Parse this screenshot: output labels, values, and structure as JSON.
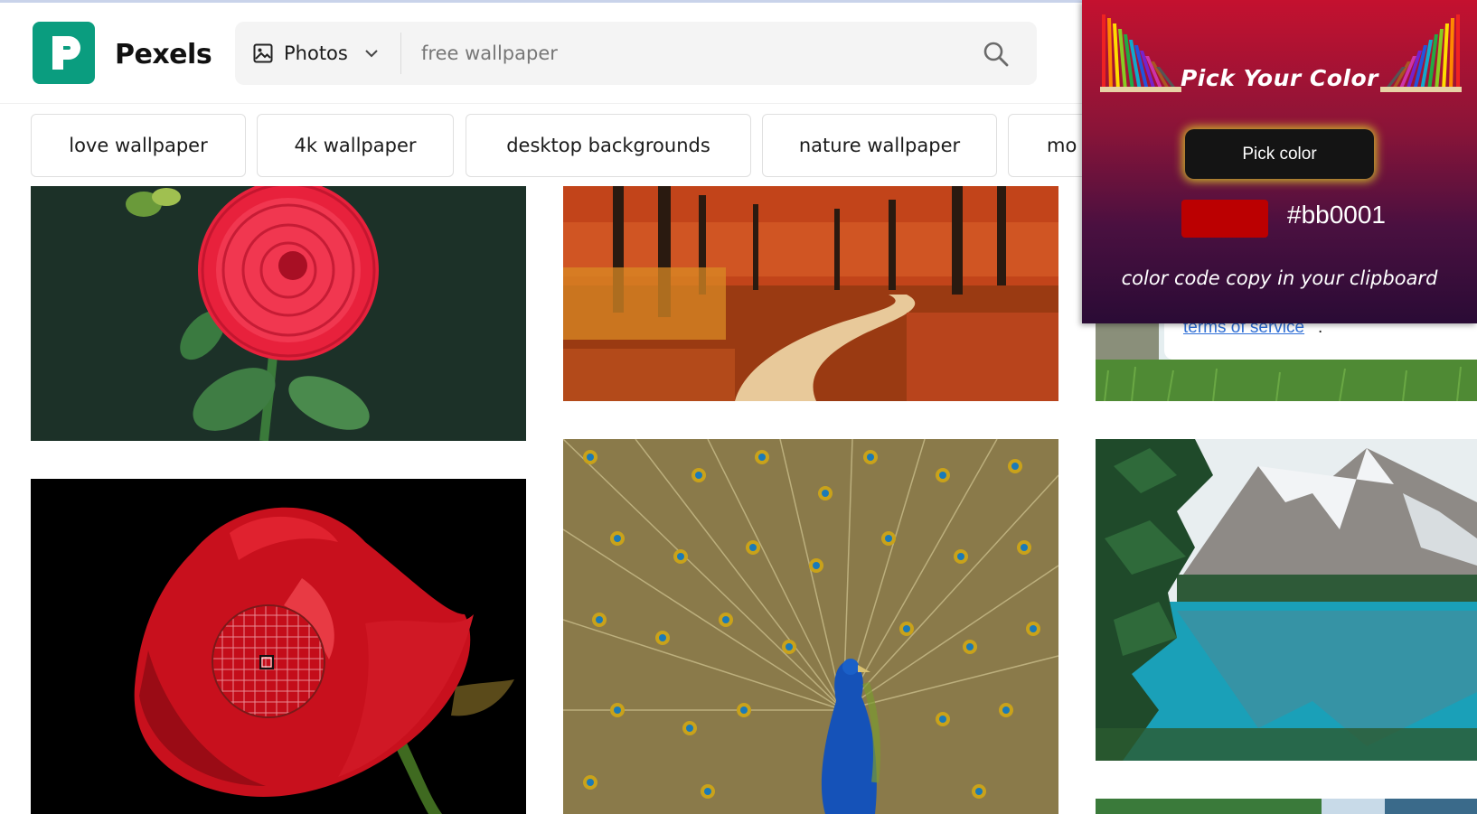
{
  "header": {
    "brand": "Pexels",
    "media_type": "Photos",
    "search": {
      "value": "free wallpaper",
      "placeholder": "free wallpaper"
    },
    "icons": {
      "logo": "pexels-logo-icon",
      "media": "image-icon",
      "chevron": "chevron-down-icon",
      "search": "search-icon"
    }
  },
  "tags": [
    {
      "label": "love wallpaper"
    },
    {
      "label": "4k wallpaper"
    },
    {
      "label": "desktop backgrounds"
    },
    {
      "label": "nature wallpaper"
    },
    {
      "label": "mo"
    }
  ],
  "cookie_notice": {
    "link_text": "terms of service",
    "suffix": "."
  },
  "color_picker": {
    "title": "Pick Your Color",
    "button_label": "Pick color",
    "hex": "#bb0001",
    "swatch_color": "#bb0001",
    "note": "color code copy in your clipboard"
  },
  "colors": {
    "brand": "#0a9d7f",
    "popup_top": "#c4112f",
    "popup_bottom": "#2a0b35"
  }
}
